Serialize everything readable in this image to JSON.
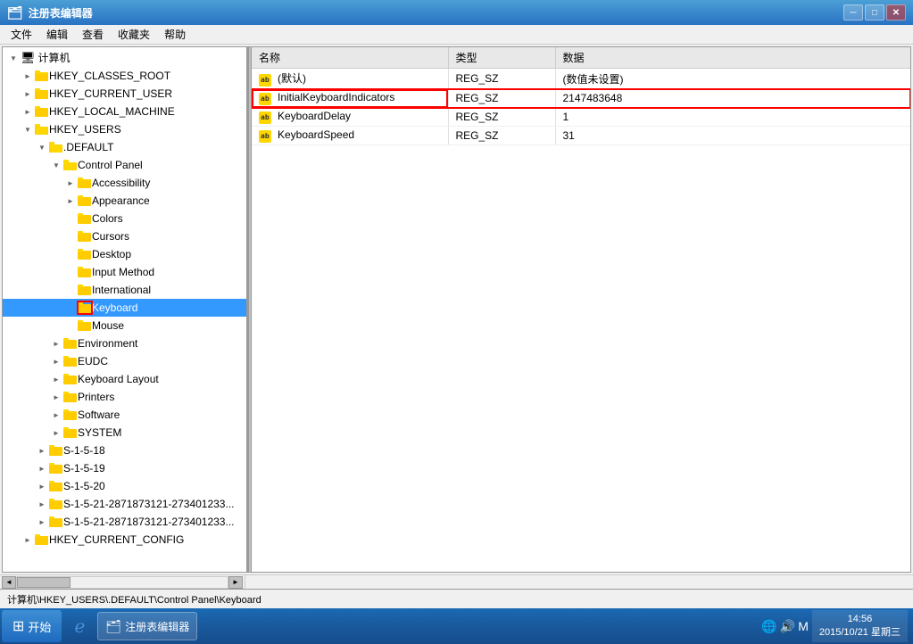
{
  "window": {
    "title": "注册表编辑器",
    "menu_items": [
      "文件",
      "编辑",
      "查看",
      "收藏夹",
      "帮助"
    ]
  },
  "tree": {
    "items": [
      {
        "id": "computer",
        "label": "计算机",
        "indent": 0,
        "expanded": true,
        "type": "computer"
      },
      {
        "id": "hkcr",
        "label": "HKEY_CLASSES_ROOT",
        "indent": 1,
        "expanded": false,
        "type": "folder"
      },
      {
        "id": "hkcu",
        "label": "HKEY_CURRENT_USER",
        "indent": 1,
        "expanded": false,
        "type": "folder"
      },
      {
        "id": "hklm",
        "label": "HKEY_LOCAL_MACHINE",
        "indent": 1,
        "expanded": false,
        "type": "folder"
      },
      {
        "id": "hku",
        "label": "HKEY_USERS",
        "indent": 1,
        "expanded": true,
        "type": "folder"
      },
      {
        "id": "default",
        "label": ".DEFAULT",
        "indent": 2,
        "expanded": true,
        "type": "folder"
      },
      {
        "id": "control_panel",
        "label": "Control Panel",
        "indent": 3,
        "expanded": true,
        "type": "folder"
      },
      {
        "id": "accessibility",
        "label": "Accessibility",
        "indent": 4,
        "expanded": false,
        "type": "folder"
      },
      {
        "id": "appearance",
        "label": "Appearance",
        "indent": 4,
        "expanded": false,
        "type": "folder"
      },
      {
        "id": "colors",
        "label": "Colors",
        "indent": 4,
        "expanded": false,
        "type": "folder"
      },
      {
        "id": "cursors",
        "label": "Cursors",
        "indent": 4,
        "expanded": false,
        "type": "folder"
      },
      {
        "id": "desktop",
        "label": "Desktop",
        "indent": 4,
        "expanded": false,
        "type": "folder"
      },
      {
        "id": "input_method",
        "label": "Input Method",
        "indent": 4,
        "expanded": false,
        "type": "folder"
      },
      {
        "id": "international",
        "label": "International",
        "indent": 4,
        "expanded": false,
        "type": "folder"
      },
      {
        "id": "keyboard",
        "label": "Keyboard",
        "indent": 4,
        "expanded": false,
        "type": "folder",
        "selected": true
      },
      {
        "id": "mouse",
        "label": "Mouse",
        "indent": 4,
        "expanded": false,
        "type": "folder"
      },
      {
        "id": "environment",
        "label": "Environment",
        "indent": 3,
        "expanded": false,
        "type": "folder"
      },
      {
        "id": "eudc",
        "label": "EUDC",
        "indent": 3,
        "expanded": false,
        "type": "folder"
      },
      {
        "id": "keyboard_layout",
        "label": "Keyboard Layout",
        "indent": 3,
        "expanded": false,
        "type": "folder"
      },
      {
        "id": "printers",
        "label": "Printers",
        "indent": 3,
        "expanded": false,
        "type": "folder"
      },
      {
        "id": "software",
        "label": "Software",
        "indent": 3,
        "expanded": false,
        "type": "folder"
      },
      {
        "id": "system",
        "label": "SYSTEM",
        "indent": 3,
        "expanded": false,
        "type": "folder"
      },
      {
        "id": "s1518",
        "label": "S-1-5-18",
        "indent": 2,
        "expanded": false,
        "type": "folder"
      },
      {
        "id": "s1519",
        "label": "S-1-5-19",
        "indent": 2,
        "expanded": false,
        "type": "folder"
      },
      {
        "id": "s1520",
        "label": "S-1-5-20",
        "indent": 2,
        "expanded": false,
        "type": "folder"
      },
      {
        "id": "s15211",
        "label": "S-1-5-21-2871873121-273401233...",
        "indent": 2,
        "expanded": false,
        "type": "folder"
      },
      {
        "id": "s15212",
        "label": "S-1-5-21-2871873121-273401233...",
        "indent": 2,
        "expanded": false,
        "type": "folder"
      },
      {
        "id": "hkcc",
        "label": "HKEY_CURRENT_CONFIG",
        "indent": 1,
        "expanded": false,
        "type": "folder"
      }
    ]
  },
  "registry_values": {
    "columns": [
      "名称",
      "类型",
      "数据"
    ],
    "rows": [
      {
        "name": "(默认)",
        "type": "REG_SZ",
        "data": "(数值未设置)",
        "selected": false,
        "highlighted": false
      },
      {
        "name": "InitialKeyboardIndicators",
        "type": "REG_SZ",
        "data": "2147483648",
        "selected": false,
        "highlighted": true
      },
      {
        "name": "KeyboardDelay",
        "type": "REG_SZ",
        "data": "1",
        "selected": false,
        "highlighted": false
      },
      {
        "name": "KeyboardSpeed",
        "type": "REG_SZ",
        "data": "31",
        "selected": false,
        "highlighted": false
      }
    ]
  },
  "status_bar": {
    "text": "计算机\\HKEY_USERS\\.DEFAULT\\Control Panel\\Keyboard"
  },
  "taskbar": {
    "start_label": "开始",
    "apps": [
      {
        "label": "注册表编辑器",
        "icon": "regedit"
      }
    ],
    "clock": {
      "time": "14:56",
      "date": "2015/10/21 星期三"
    }
  }
}
